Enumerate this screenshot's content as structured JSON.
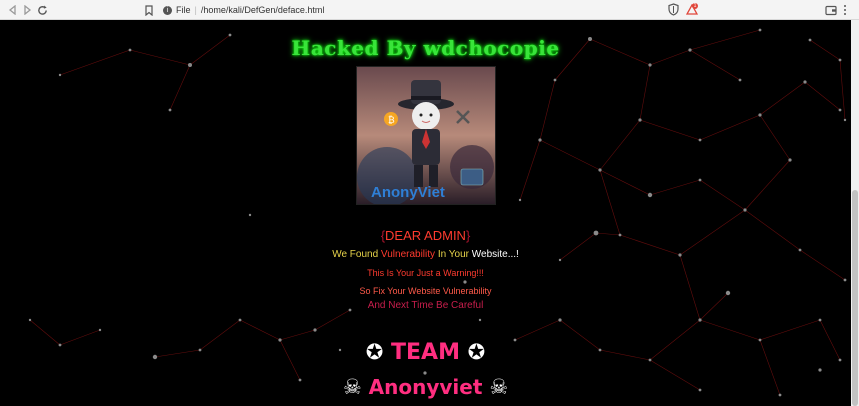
{
  "browser": {
    "file_label": "File",
    "url": "/home/kali/DefGen/deface.html",
    "badge_count": "1"
  },
  "page": {
    "title": "Hacked By wdchocopie",
    "image_caption": "AnonyViet",
    "dear": "DEAR ADMIN",
    "found": {
      "we_found": "We Found",
      "vulnerability": "Vulnerability",
      "in_your": "In Your",
      "website": "Website...!"
    },
    "warning": "This Is Your Just a Warning!!!",
    "fix": "So Fix Your Website Vulnerability",
    "next": "And Next Time Be Careful",
    "team": "TEAM",
    "anony": "Anonyviet"
  },
  "colors": {
    "title": "#39e43a",
    "accent_red": "#ff3b2f",
    "pink": "#ff2e80",
    "yellow": "#e6d34a"
  }
}
